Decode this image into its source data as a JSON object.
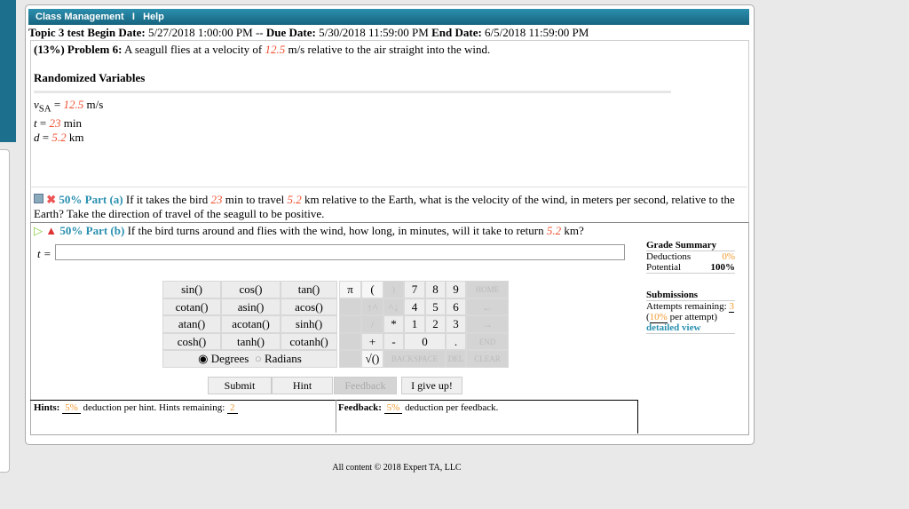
{
  "nav": {
    "class_management": "Class Management",
    "separator": "I",
    "help": "Help"
  },
  "topic": {
    "name": "Topic 3 test",
    "begin_label": "Begin Date:",
    "begin": "5/27/2018 1:00:00 PM",
    "sep": "--",
    "due_label": "Due Date:",
    "due": "5/30/2018 11:59:00 PM",
    "end_label": "End Date:",
    "end": "6/5/2018 11:59:00 PM"
  },
  "problem": {
    "weight": "(13%)",
    "label": "Problem 6:",
    "text_a": "A seagull flies at a velocity of",
    "value": "12.5",
    "text_b": "m/s relative to the air straight into the wind."
  },
  "variables": {
    "heading": "Randomized Variables",
    "items": [
      {
        "name": "v",
        "sub": "SA",
        "value": "12.5",
        "unit": "m/s"
      },
      {
        "name": "t",
        "value": "23",
        "unit": "min"
      },
      {
        "name": "d",
        "value": "5.2",
        "unit": "km"
      }
    ]
  },
  "part_a": {
    "label": "50% Part (a)",
    "t1": "If it takes the bird",
    "v1": "23",
    "t2": "min to travel",
    "v2": "5.2",
    "t3": "km relative to the Earth, what is the velocity of the wind, in meters per second, relative to the Earth? Take the direction of travel of the seagull to be positive."
  },
  "part_b": {
    "label": "50% Part (b)",
    "t1": "If the bird turns around and flies with the wind, how long, in minutes, will it take to return",
    "v1": "5.2",
    "t2": "km?",
    "input_label": "t =",
    "input_value": ""
  },
  "calc": {
    "funcs": [
      "sin()",
      "cos()",
      "tan()",
      "cotan()",
      "asin()",
      "acos()",
      "atan()",
      "acotan()",
      "sinh()",
      "cosh()",
      "tanh()",
      "cotanh()"
    ],
    "degrees": "Degrees",
    "radians": "Radians",
    "keys": {
      "pi": "π",
      "lp": "(",
      "rp": ")",
      "k7": "7",
      "k8": "8",
      "k9": "9",
      "home": "HOME",
      "up": "↑^",
      "down": "^↓",
      "k4": "4",
      "k5": "5",
      "k6": "6",
      "left": "←",
      "div": "/",
      "mul": "*",
      "k1": "1",
      "k2": "2",
      "k3": "3",
      "right": "→",
      "plus": "+",
      "minus": "-",
      "k0": "0",
      "dot": ".",
      "end": "END",
      "sqrt": "√()",
      "backspace": "BACKSPACE",
      "del": "DEL",
      "clear": "CLEAR"
    }
  },
  "buttons": {
    "submit": "Submit",
    "hint": "Hint",
    "feedback": "Feedback",
    "give_up": "I give up!"
  },
  "hints": {
    "label": "Hints:",
    "pct": "5%",
    "text": "deduction per hint. Hints remaining:",
    "remaining": "2"
  },
  "feedback": {
    "label": "Feedback:",
    "pct": "5%",
    "text": "deduction per feedback."
  },
  "grade": {
    "title": "Grade Summary",
    "deductions_label": "Deductions",
    "deductions": "0%",
    "potential_label": "Potential",
    "potential": "100%"
  },
  "submissions": {
    "title": "Submissions",
    "attempts_label": "Attempts remaining:",
    "attempts": "3",
    "open": "(",
    "per": "10%",
    "per_text": "per attempt)",
    "detail": "detailed view"
  },
  "footer": "All content © 2018 Expert TA, LLC"
}
